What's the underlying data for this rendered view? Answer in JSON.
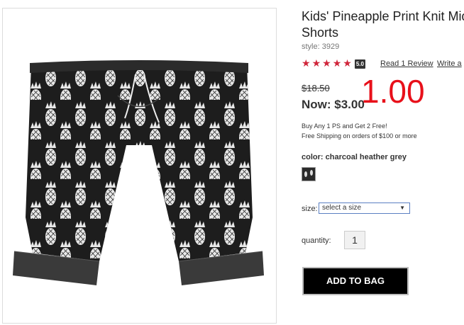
{
  "product": {
    "title_line1": "Kids' Pineapple Print Knit Mid",
    "title_line2": "Shorts",
    "style": "style: 3929",
    "rating_value": "5.0",
    "stars": 5,
    "review_link": "Read 1 Review",
    "write_link": "Write a",
    "old_price": "$18.50",
    "now_price": "Now: $3.00",
    "overlay_price": "1.00",
    "promo_line1": "Buy Any 1 PS and Get 2 Free!",
    "promo_line2": "Free Shipping on orders of $100 or more",
    "color_label": "color:",
    "color_value": "charcoal heather grey",
    "size_label": "size:",
    "size_selected": "select a size",
    "quantity_label": "quantity:",
    "quantity_value": "1",
    "add_button": "ADD TO BAG"
  },
  "colors": {
    "accent_red": "#e8101a",
    "star_red": "#d0253a",
    "button_bg": "#000000"
  }
}
